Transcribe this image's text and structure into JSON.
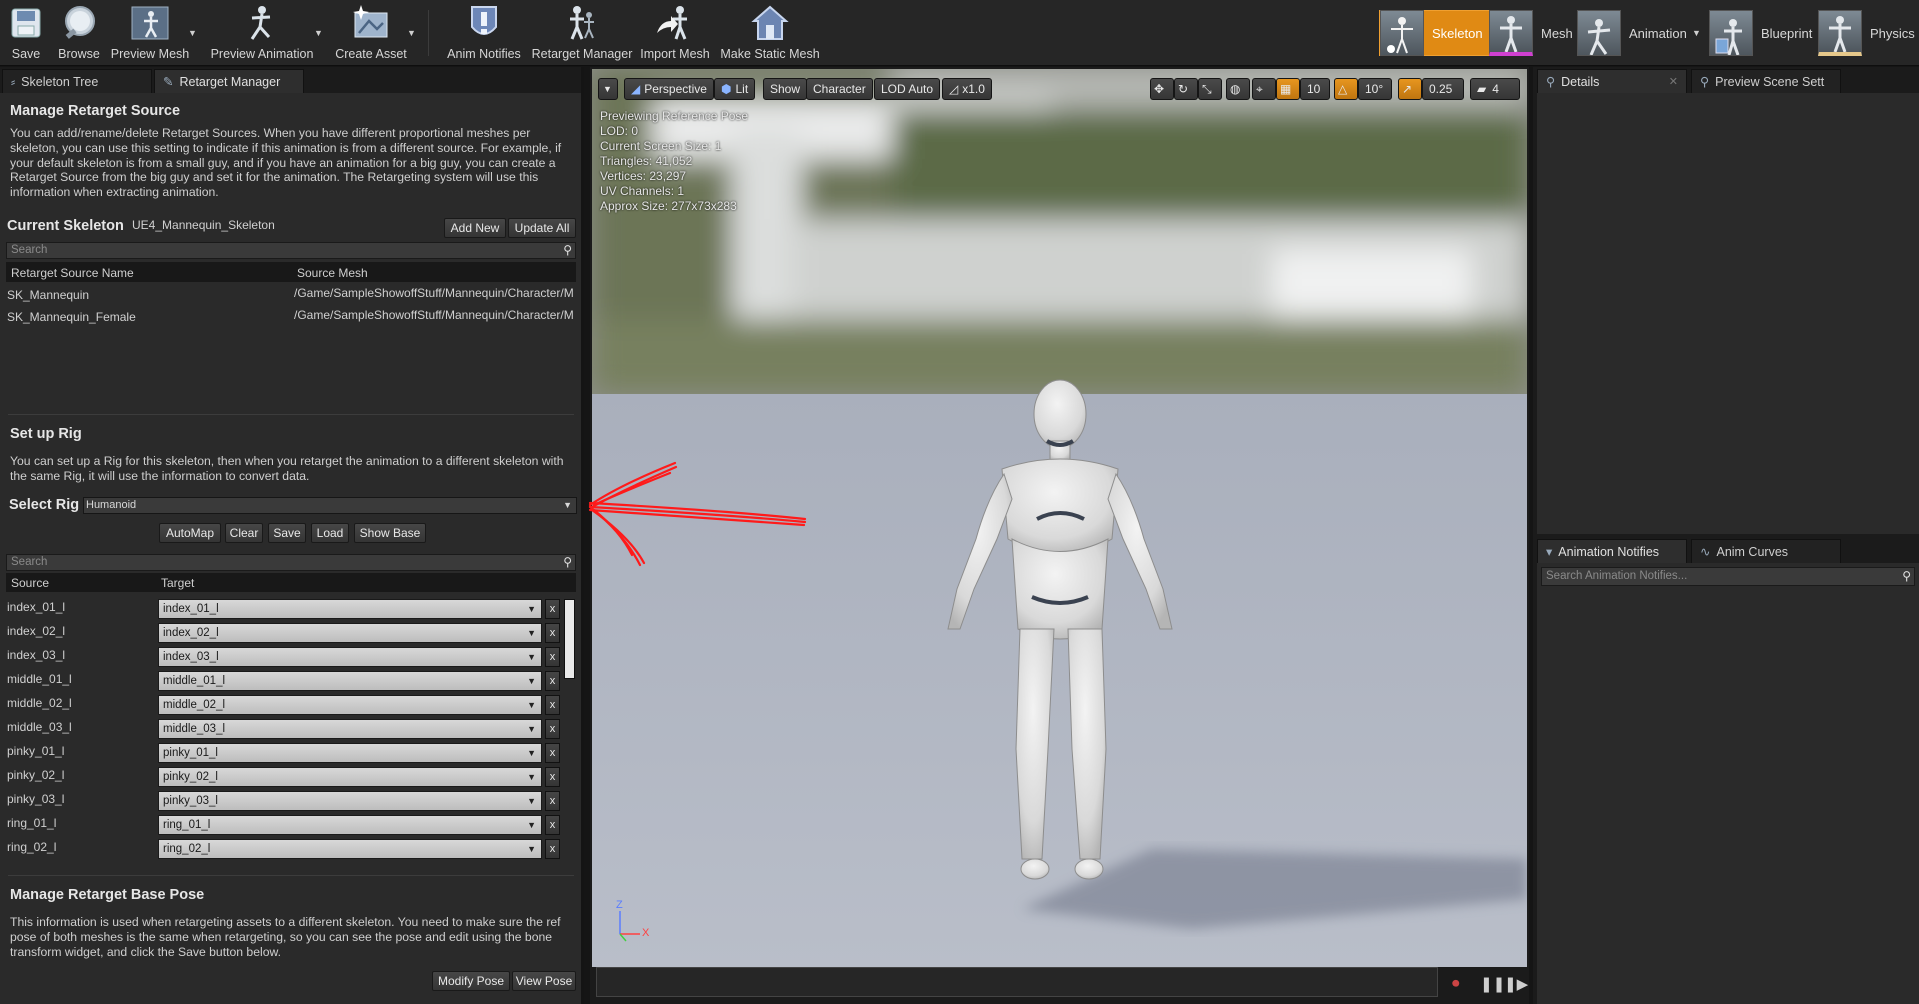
{
  "toolbar": {
    "buttons": [
      {
        "label": "Save",
        "icon": "save-icon"
      },
      {
        "label": "Browse",
        "icon": "browse-icon"
      },
      {
        "label": "Preview Mesh",
        "icon": "preview-mesh-icon"
      },
      {
        "label": "Preview Animation",
        "icon": "preview-animation-icon"
      },
      {
        "label": "Create Asset",
        "icon": "create-asset-icon"
      },
      {
        "label": "Anim Notifies",
        "icon": "anim-notifies-icon"
      },
      {
        "label": "Retarget Manager",
        "icon": "retarget-manager-icon"
      },
      {
        "label": "Import Mesh",
        "icon": "import-mesh-icon"
      },
      {
        "label": "Make Static Mesh",
        "icon": "make-static-mesh-icon"
      }
    ],
    "modes": [
      {
        "label": "Skeleton",
        "active": true
      },
      {
        "label": "Mesh",
        "active": false
      },
      {
        "label": "Animation",
        "active": false
      },
      {
        "label": "Blueprint",
        "active": false
      },
      {
        "label": "Physics",
        "active": false
      }
    ],
    "accent": "#e08a14"
  },
  "left_tabs": [
    {
      "label": "Skeleton Tree",
      "active": false
    },
    {
      "label": "Retarget Manager",
      "active": true
    }
  ],
  "retarget_source": {
    "title": "Manage Retarget Source",
    "description": "You can add/rename/delete Retarget Sources. When you have different proportional meshes per skeleton, you can use this setting to indicate if this animation is from a different source. For example, if your default skeleton is from a small guy, and if you have an animation for a big guy, you can create a Retarget Source from the big guy and set it for the animation. The Retargeting system will use this information when extracting animation.",
    "current_skeleton_label": "Current Skeleton",
    "current_skeleton_value": "UE4_Mannequin_Skeleton",
    "add_new": "Add New",
    "update_all": "Update All",
    "search_placeholder": "Search",
    "col_name": "Retarget Source Name",
    "col_mesh": "Source Mesh",
    "rows": [
      {
        "name": "SK_Mannequin",
        "mesh": "/Game/SampleShowoffStuff/Mannequin/Character/M"
      },
      {
        "name": "SK_Mannequin_Female",
        "mesh": "/Game/SampleShowoffStuff/Mannequin/Character/M"
      }
    ]
  },
  "rig": {
    "title": "Set up Rig",
    "description": "You can set up a Rig for this skeleton, then when you retarget the animation to a different skeleton with the same Rig, it will use the information to convert data.",
    "select_label": "Select Rig",
    "select_value": "Humanoid",
    "buttons": [
      "AutoMap",
      "Clear",
      "Save",
      "Load",
      "Show Base"
    ],
    "search_placeholder": "Search",
    "col_source": "Source",
    "col_target": "Target",
    "mappings": [
      {
        "source": "index_01_l",
        "target": "index_01_l"
      },
      {
        "source": "index_02_l",
        "target": "index_02_l"
      },
      {
        "source": "index_03_l",
        "target": "index_03_l"
      },
      {
        "source": "middle_01_l",
        "target": "middle_01_l"
      },
      {
        "source": "middle_02_l",
        "target": "middle_02_l"
      },
      {
        "source": "middle_03_l",
        "target": "middle_03_l"
      },
      {
        "source": "pinky_01_l",
        "target": "pinky_01_l"
      },
      {
        "source": "pinky_02_l",
        "target": "pinky_02_l"
      },
      {
        "source": "pinky_03_l",
        "target": "pinky_03_l"
      },
      {
        "source": "ring_01_l",
        "target": "ring_01_l"
      },
      {
        "source": "ring_02_l",
        "target": "ring_02_l"
      }
    ],
    "clear_glyph": "x"
  },
  "base_pose": {
    "title": "Manage Retarget Base Pose",
    "description": "This information is used when retargeting assets to a different skeleton. You need to make sure the ref pose of both meshes is the same when retargeting, so you can see the pose and edit using the bone transform widget, and click the Save button below.",
    "modify": "Modify Pose",
    "view": "View Pose"
  },
  "viewport": {
    "perspective": "Perspective",
    "lit": "Lit",
    "show": "Show",
    "character": "Character",
    "lod": "LOD Auto",
    "speed": "x1.0",
    "grid": "10",
    "rot": "10°",
    "scale": "0.25",
    "cam": "4",
    "stats": [
      "Previewing Reference Pose",
      "LOD: 0",
      "Current Screen Size: 1",
      "Triangles: 41,052",
      "Vertices: 23,297",
      "UV Channels: 1",
      "Approx Size: 277x73x283"
    ],
    "axis_z": "Z",
    "axis_x": "X"
  },
  "right": {
    "top_tabs": [
      {
        "label": "Details"
      },
      {
        "label": "Preview Scene Sett"
      }
    ],
    "bottom_tabs": [
      {
        "label": "Animation Notifies"
      },
      {
        "label": "Anim Curves"
      }
    ],
    "notifies_search": "Search Animation Notifies..."
  }
}
